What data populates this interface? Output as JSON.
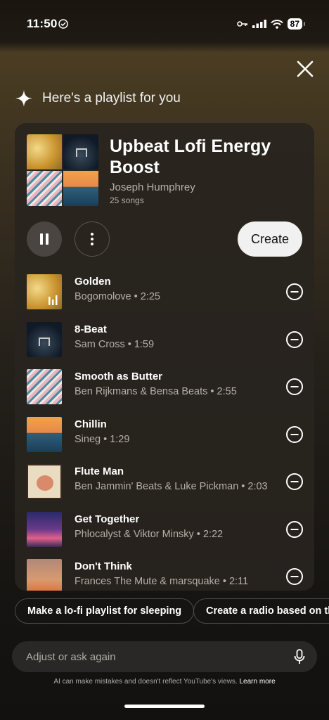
{
  "status": {
    "time": "11:50",
    "battery": "87"
  },
  "header": {
    "title": "Here's a playlist for you"
  },
  "playlist": {
    "title": "Upbeat Lofi Energy Boost",
    "author": "Joseph Humphrey",
    "count": "25 songs",
    "create_label": "Create"
  },
  "songs": [
    {
      "title": "Golden",
      "subtitle": "Bogomolove • 2:25"
    },
    {
      "title": "8-Beat",
      "subtitle": "Sam Cross • 1:59"
    },
    {
      "title": "Smooth as Butter",
      "subtitle": "Ben Rijkmans & Bensa Beats • 2:55"
    },
    {
      "title": "Chillin",
      "subtitle": "Sineg • 1:29"
    },
    {
      "title": "Flute Man",
      "subtitle": "Ben Jammin' Beats & Luke Pickman • 2:03"
    },
    {
      "title": "Get Together",
      "subtitle": "Phlocalyst & Viktor Minsky • 2:22"
    },
    {
      "title": "Don't Think",
      "subtitle": "Frances The Mute & marsquake • 2:11"
    }
  ],
  "suggestions": [
    "Make a lo-fi playlist for sleeping",
    "Create a radio based on the"
  ],
  "ask": {
    "placeholder": "Adjust or ask again"
  },
  "disclaimer": {
    "text": "AI can make mistakes and doesn't reflect YouTube's views.",
    "link": "Learn more"
  },
  "icons": {
    "close": "close-icon",
    "sparkle": "sparkle-icon",
    "pause": "pause-icon",
    "more": "more-vert-icon",
    "remove": "remove-circle-icon",
    "mic": "mic-icon",
    "playing": "equalizer-icon"
  }
}
